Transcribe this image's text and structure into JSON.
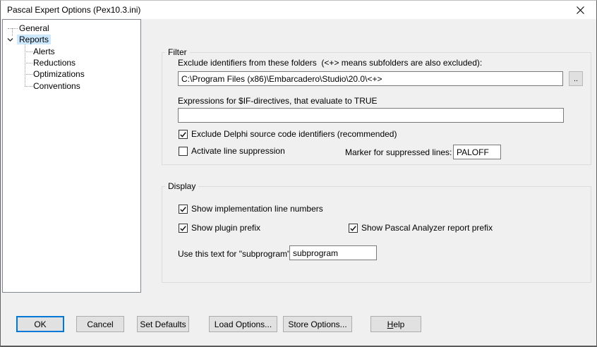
{
  "window": {
    "title": "Pascal Expert Options (Pex10.3.ini)"
  },
  "tree": {
    "items": [
      {
        "label": "General",
        "level": 0,
        "selected": false
      },
      {
        "label": "Reports",
        "level": 0,
        "selected": true,
        "expanded": true
      },
      {
        "label": "Alerts",
        "level": 1,
        "selected": false
      },
      {
        "label": "Reductions",
        "level": 1,
        "selected": false
      },
      {
        "label": "Optimizations",
        "level": 1,
        "selected": false
      },
      {
        "label": "Conventions",
        "level": 1,
        "selected": false
      }
    ]
  },
  "filter": {
    "legend": "Filter",
    "exclude_label": "Exclude identifiers from these folders  (<+> means subfolders are also excluded):",
    "exclude_value": "C:\\Program Files (x86)\\Embarcadero\\Studio\\20.0\\<+>",
    "browse_label": "..",
    "expressions_label": "Expressions for $IF-directives, that evaluate to TRUE",
    "expressions_value": "",
    "exclude_delphi": {
      "label": "Exclude Delphi source code identifiers (recommended)",
      "checked": true
    },
    "activate_suppression": {
      "label": "Activate line suppression",
      "checked": false
    },
    "marker_label": "Marker for suppressed lines:",
    "marker_value": "PALOFF"
  },
  "display": {
    "legend": "Display",
    "impl_numbers": {
      "label": "Show implementation line numbers",
      "checked": true
    },
    "plugin_prefix": {
      "label": "Show plugin prefix",
      "checked": true
    },
    "pa_prefix": {
      "label": "Show Pascal Analyzer report prefix",
      "checked": true
    },
    "subprogram_label": "Use this text for \"subprogram\":",
    "subprogram_value": "subprogram"
  },
  "buttons": {
    "ok": "OK",
    "cancel": "Cancel",
    "set_defaults": "Set Defaults",
    "load_options": "Load Options...",
    "store_options": "Store Options...",
    "help_accel": "H",
    "help_rest": "elp"
  },
  "colors": {
    "accent": "#0078d7",
    "tree_selection": "#cce8ff",
    "dialog_bg": "#f0f0f0"
  }
}
